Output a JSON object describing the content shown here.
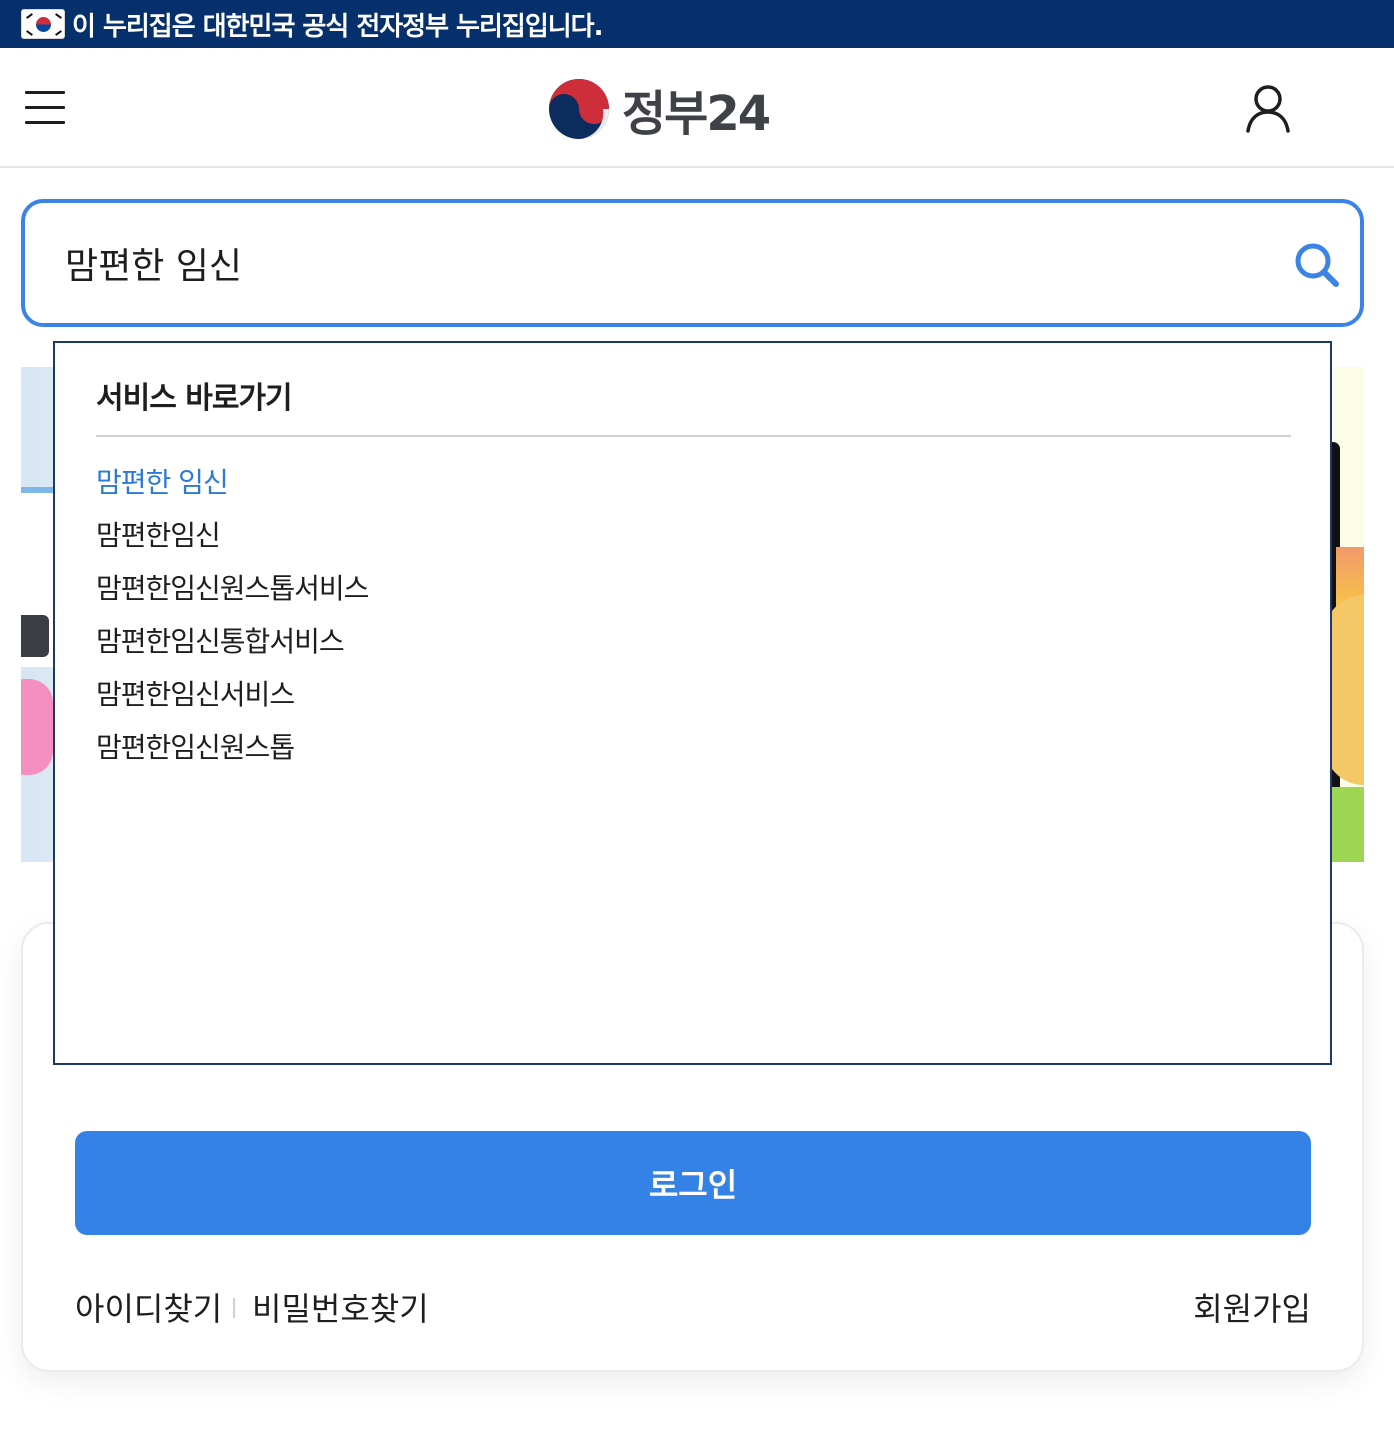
{
  "gov_banner": {
    "text": "이 누리집은 대한민국 공식 전자정부 누리집입니다."
  },
  "header": {
    "logo_text": "정부24"
  },
  "search": {
    "query": "맘편한 임신"
  },
  "suggestions": {
    "title": "서비스 바로가기",
    "items": [
      {
        "label": "맘편한 임신"
      },
      {
        "label": "맘편한임신"
      },
      {
        "label": "맘편한임신원스톱서비스"
      },
      {
        "label": "맘편한임신통합서비스"
      },
      {
        "label": "맘편한임신서비스"
      },
      {
        "label": "맘편한임신원스톱"
      }
    ]
  },
  "login": {
    "button_label": "로그인",
    "find_id": "아이디찾기",
    "find_password": "비밀번호찾기",
    "signup": "회원가입"
  },
  "colors": {
    "gov_banner": "#05306b",
    "accent": "#3b83e4",
    "login_button": "#3582e6",
    "suggestion_active": "#2b7ad9",
    "suggestion_border": "#1b3a6b"
  }
}
